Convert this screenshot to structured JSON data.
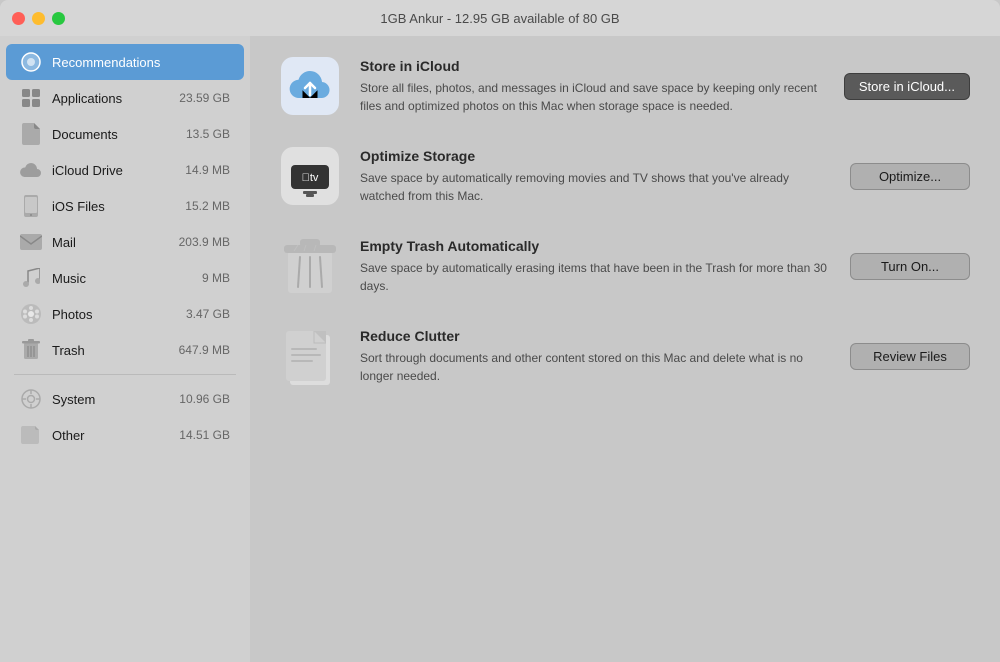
{
  "titleBar": {
    "title": "1GB Ankur - 12.95 GB available of 80 GB"
  },
  "sidebar": {
    "activeItem": "recommendations",
    "items": [
      {
        "id": "recommendations",
        "label": "Recommendations",
        "size": "",
        "icon": "star"
      },
      {
        "id": "applications",
        "label": "Applications",
        "size": "23.59 GB",
        "icon": "grid"
      },
      {
        "id": "documents",
        "label": "Documents",
        "size": "13.5 GB",
        "icon": "doc"
      },
      {
        "id": "icloud-drive",
        "label": "iCloud Drive",
        "size": "14.9 MB",
        "icon": "cloud"
      },
      {
        "id": "ios-files",
        "label": "iOS Files",
        "size": "15.2 MB",
        "icon": "phone"
      },
      {
        "id": "mail",
        "label": "Mail",
        "size": "203.9 MB",
        "icon": "mail"
      },
      {
        "id": "music",
        "label": "Music",
        "size": "9 MB",
        "icon": "music"
      },
      {
        "id": "photos",
        "label": "Photos",
        "size": "3.47 GB",
        "icon": "flower"
      },
      {
        "id": "trash",
        "label": "Trash",
        "size": "647.9 MB",
        "icon": "trash"
      }
    ],
    "footerItems": [
      {
        "id": "system",
        "label": "System",
        "size": "10.96 GB",
        "icon": "gear"
      },
      {
        "id": "other",
        "label": "Other",
        "size": "14.51 GB",
        "icon": "folder"
      }
    ]
  },
  "recommendations": [
    {
      "id": "store-icloud",
      "title": "Store in iCloud",
      "description": "Store all files, photos, and messages in iCloud and save space by keeping only recent files and optimized photos on this Mac when storage space is needed.",
      "buttonLabel": "Store in iCloud...",
      "buttonPrimary": true
    },
    {
      "id": "optimize-storage",
      "title": "Optimize Storage",
      "description": "Save space by automatically removing movies and TV shows that you've already watched from this Mac.",
      "buttonLabel": "Optimize...",
      "buttonPrimary": false
    },
    {
      "id": "empty-trash",
      "title": "Empty Trash Automatically",
      "description": "Save space by automatically erasing items that have been in the Trash for more than 30 days.",
      "buttonLabel": "Turn On...",
      "buttonPrimary": false
    },
    {
      "id": "reduce-clutter",
      "title": "Reduce Clutter",
      "description": "Sort through documents and other content stored on this Mac and delete what is no longer needed.",
      "buttonLabel": "Review Files",
      "buttonPrimary": false
    }
  ]
}
